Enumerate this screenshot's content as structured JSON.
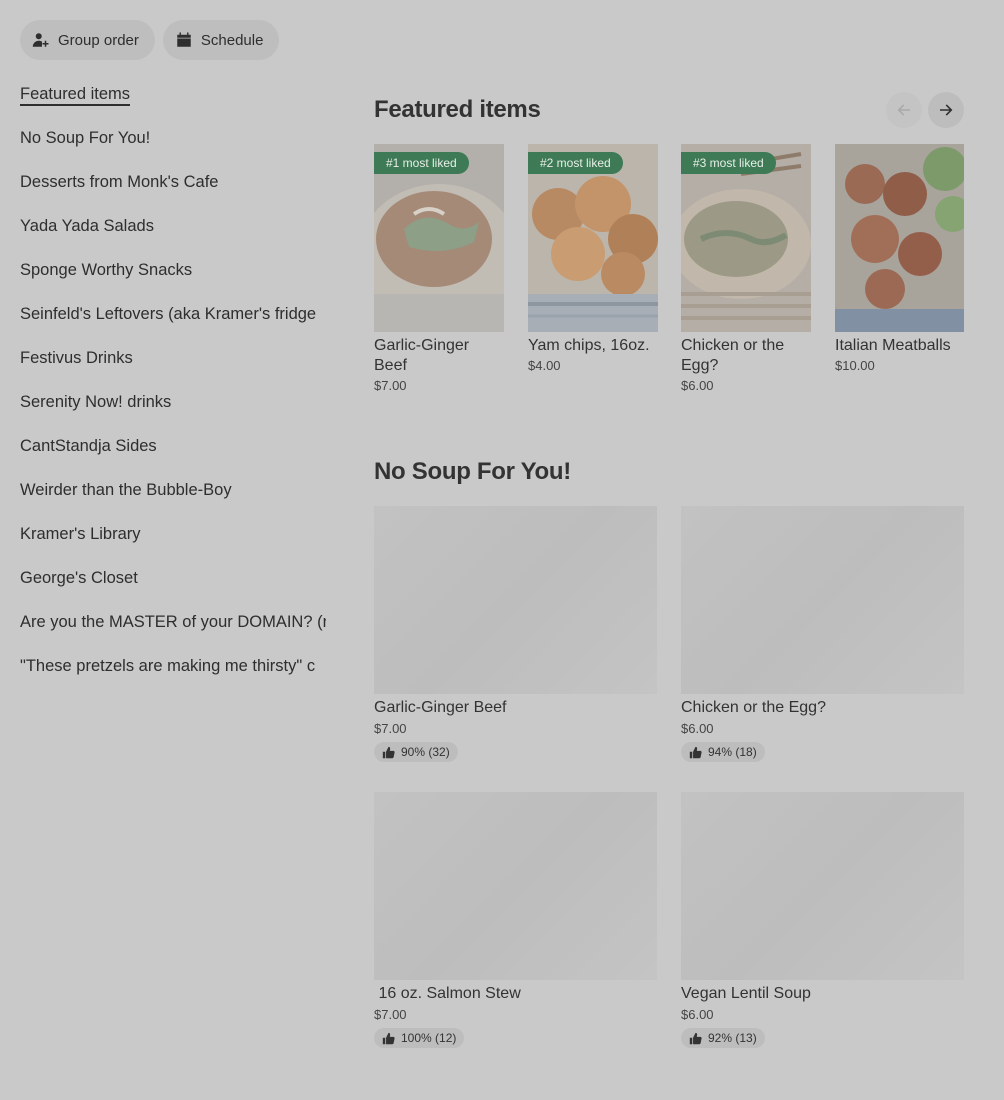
{
  "top_buttons": {
    "group_order": "Group order",
    "schedule": "Schedule"
  },
  "sidebar": {
    "items": [
      {
        "label": "Featured items",
        "active": true
      },
      {
        "label": "No Soup For You!"
      },
      {
        "label": "Desserts from Monk's Cafe"
      },
      {
        "label": "Yada Yada Salads"
      },
      {
        "label": "Sponge Worthy Snacks"
      },
      {
        "label": "Seinfeld's Leftovers (aka Kramer's fridge"
      },
      {
        "label": "Festivus Drinks"
      },
      {
        "label": "Serenity Now! drinks"
      },
      {
        "label": "CantStandja Sides"
      },
      {
        "label": "Weirder than the Bubble-Boy"
      },
      {
        "label": "Kramer's Library"
      },
      {
        "label": "George's Closet"
      },
      {
        "label": "Are you the MASTER of your DOMAIN? (r"
      },
      {
        "label": "\"These pretzels are making me thirsty\" c"
      }
    ]
  },
  "featured": {
    "title": "Featured items",
    "prev_icon": "arrow-left-icon",
    "next_icon": "arrow-right-icon",
    "items": [
      {
        "badge": "#1 most liked",
        "name": "Garlic-Ginger Beef",
        "price": "$7.00"
      },
      {
        "badge": "#2 most liked",
        "name": "Yam chips, 16oz.",
        "price": "$4.00"
      },
      {
        "badge": "#3 most liked",
        "name": "Chicken or the Egg?",
        "price": "$6.00"
      },
      {
        "badge": "",
        "name": "Italian Meatballs",
        "price": "$10.00"
      }
    ]
  },
  "no_soup": {
    "title": "No Soup For You!",
    "items": [
      {
        "name": "Garlic-Ginger Beef",
        "price": "$7.00",
        "rating": "90% (32)"
      },
      {
        "name": "Chicken or the Egg?",
        "price": "$6.00",
        "rating": "94% (18)"
      },
      {
        "name": " 16 oz. Salmon Stew",
        "price": "$7.00",
        "rating": "100% (12)"
      },
      {
        "name": "Vegan Lentil Soup",
        "price": "$6.00",
        "rating": "92% (13)"
      }
    ]
  },
  "colors": {
    "background": "#c9c9c9",
    "badge": "#3d7a55"
  }
}
